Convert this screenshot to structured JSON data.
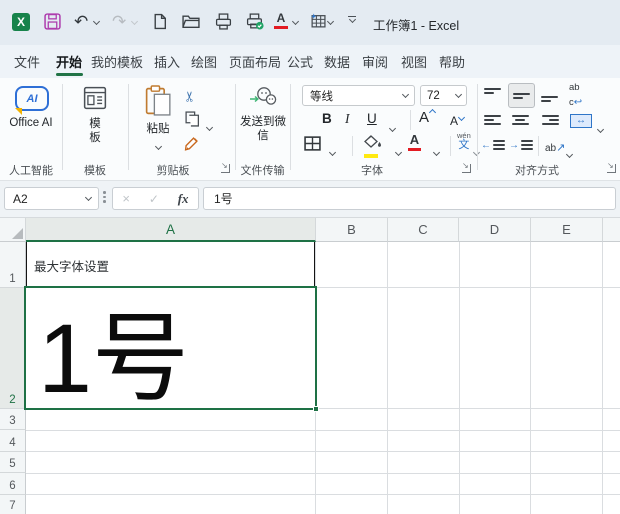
{
  "titlebar": {
    "title": "工作簿1 - Excel"
  },
  "tabs": [
    {
      "label": "文件"
    },
    {
      "label": "开始",
      "active": true
    },
    {
      "label": "我的模板"
    },
    {
      "label": "插入"
    },
    {
      "label": "绘图"
    },
    {
      "label": "页面布局"
    },
    {
      "label": "公式"
    },
    {
      "label": "数据"
    },
    {
      "label": "审阅"
    },
    {
      "label": "视图"
    },
    {
      "label": "帮助"
    }
  ],
  "ribbon": {
    "ai_group": {
      "button": "Office AI",
      "label": "人工智能"
    },
    "template_group": {
      "button": "模板",
      "label": "模板"
    },
    "clipboard_group": {
      "paste": "粘贴",
      "label": "剪贴板"
    },
    "transfer_group": {
      "button": "发送到微信",
      "label": "文件传输"
    },
    "font_group": {
      "font_name": "等线",
      "font_size": "72",
      "bold": "B",
      "italic": "I",
      "underline": "U",
      "grow_font": "A",
      "shrink_font": "A",
      "font_color": "A",
      "pinyin_top": "wén",
      "pinyin_bottom": "文",
      "label": "字体"
    },
    "align_group": {
      "wrap_ab": "ab",
      "wrap_c": "c",
      "orient_ab": "ab",
      "label": "对齐方式"
    }
  },
  "formula_bar": {
    "name_box": "A2",
    "fx": "fx",
    "value": "1号"
  },
  "grid": {
    "columns": [
      "A",
      "B",
      "C",
      "D",
      "E"
    ],
    "rows": [
      "1",
      "2",
      "3",
      "4",
      "5",
      "6",
      "7"
    ],
    "cells": {
      "a1": "最大字体设置",
      "a2": "1号"
    },
    "selected_cell": "A2"
  },
  "colors": {
    "accent_green": "#217346",
    "font_color_red": "#e31b23",
    "fill_yellow": "#ffe910",
    "blue_accent": "#2e75c8"
  }
}
